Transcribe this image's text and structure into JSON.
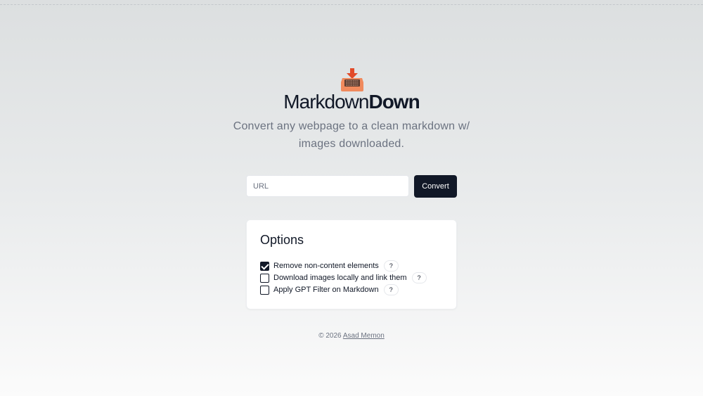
{
  "brand": {
    "part1": "Markdown",
    "part2": "Down"
  },
  "tagline": "Convert any webpage to a clean markdown w/ images downloaded.",
  "url_input": {
    "placeholder": "URL",
    "value": ""
  },
  "convert_button": {
    "label": "Convert"
  },
  "options": {
    "title": "Options",
    "items": [
      {
        "label": "Remove non-content elements",
        "checked": true,
        "help": "?"
      },
      {
        "label": "Download images locally and link them",
        "checked": false,
        "help": "?"
      },
      {
        "label": "Apply GPT Filter on Markdown",
        "checked": false,
        "help": "?"
      }
    ]
  },
  "footer": {
    "copyright": "© 2026",
    "author_link": "Asad Memon"
  },
  "colors": {
    "primary": "#111827",
    "logo_accent": "#f08a5d",
    "logo_arrow": "#e24b2a",
    "muted_text": "#6b7280"
  }
}
